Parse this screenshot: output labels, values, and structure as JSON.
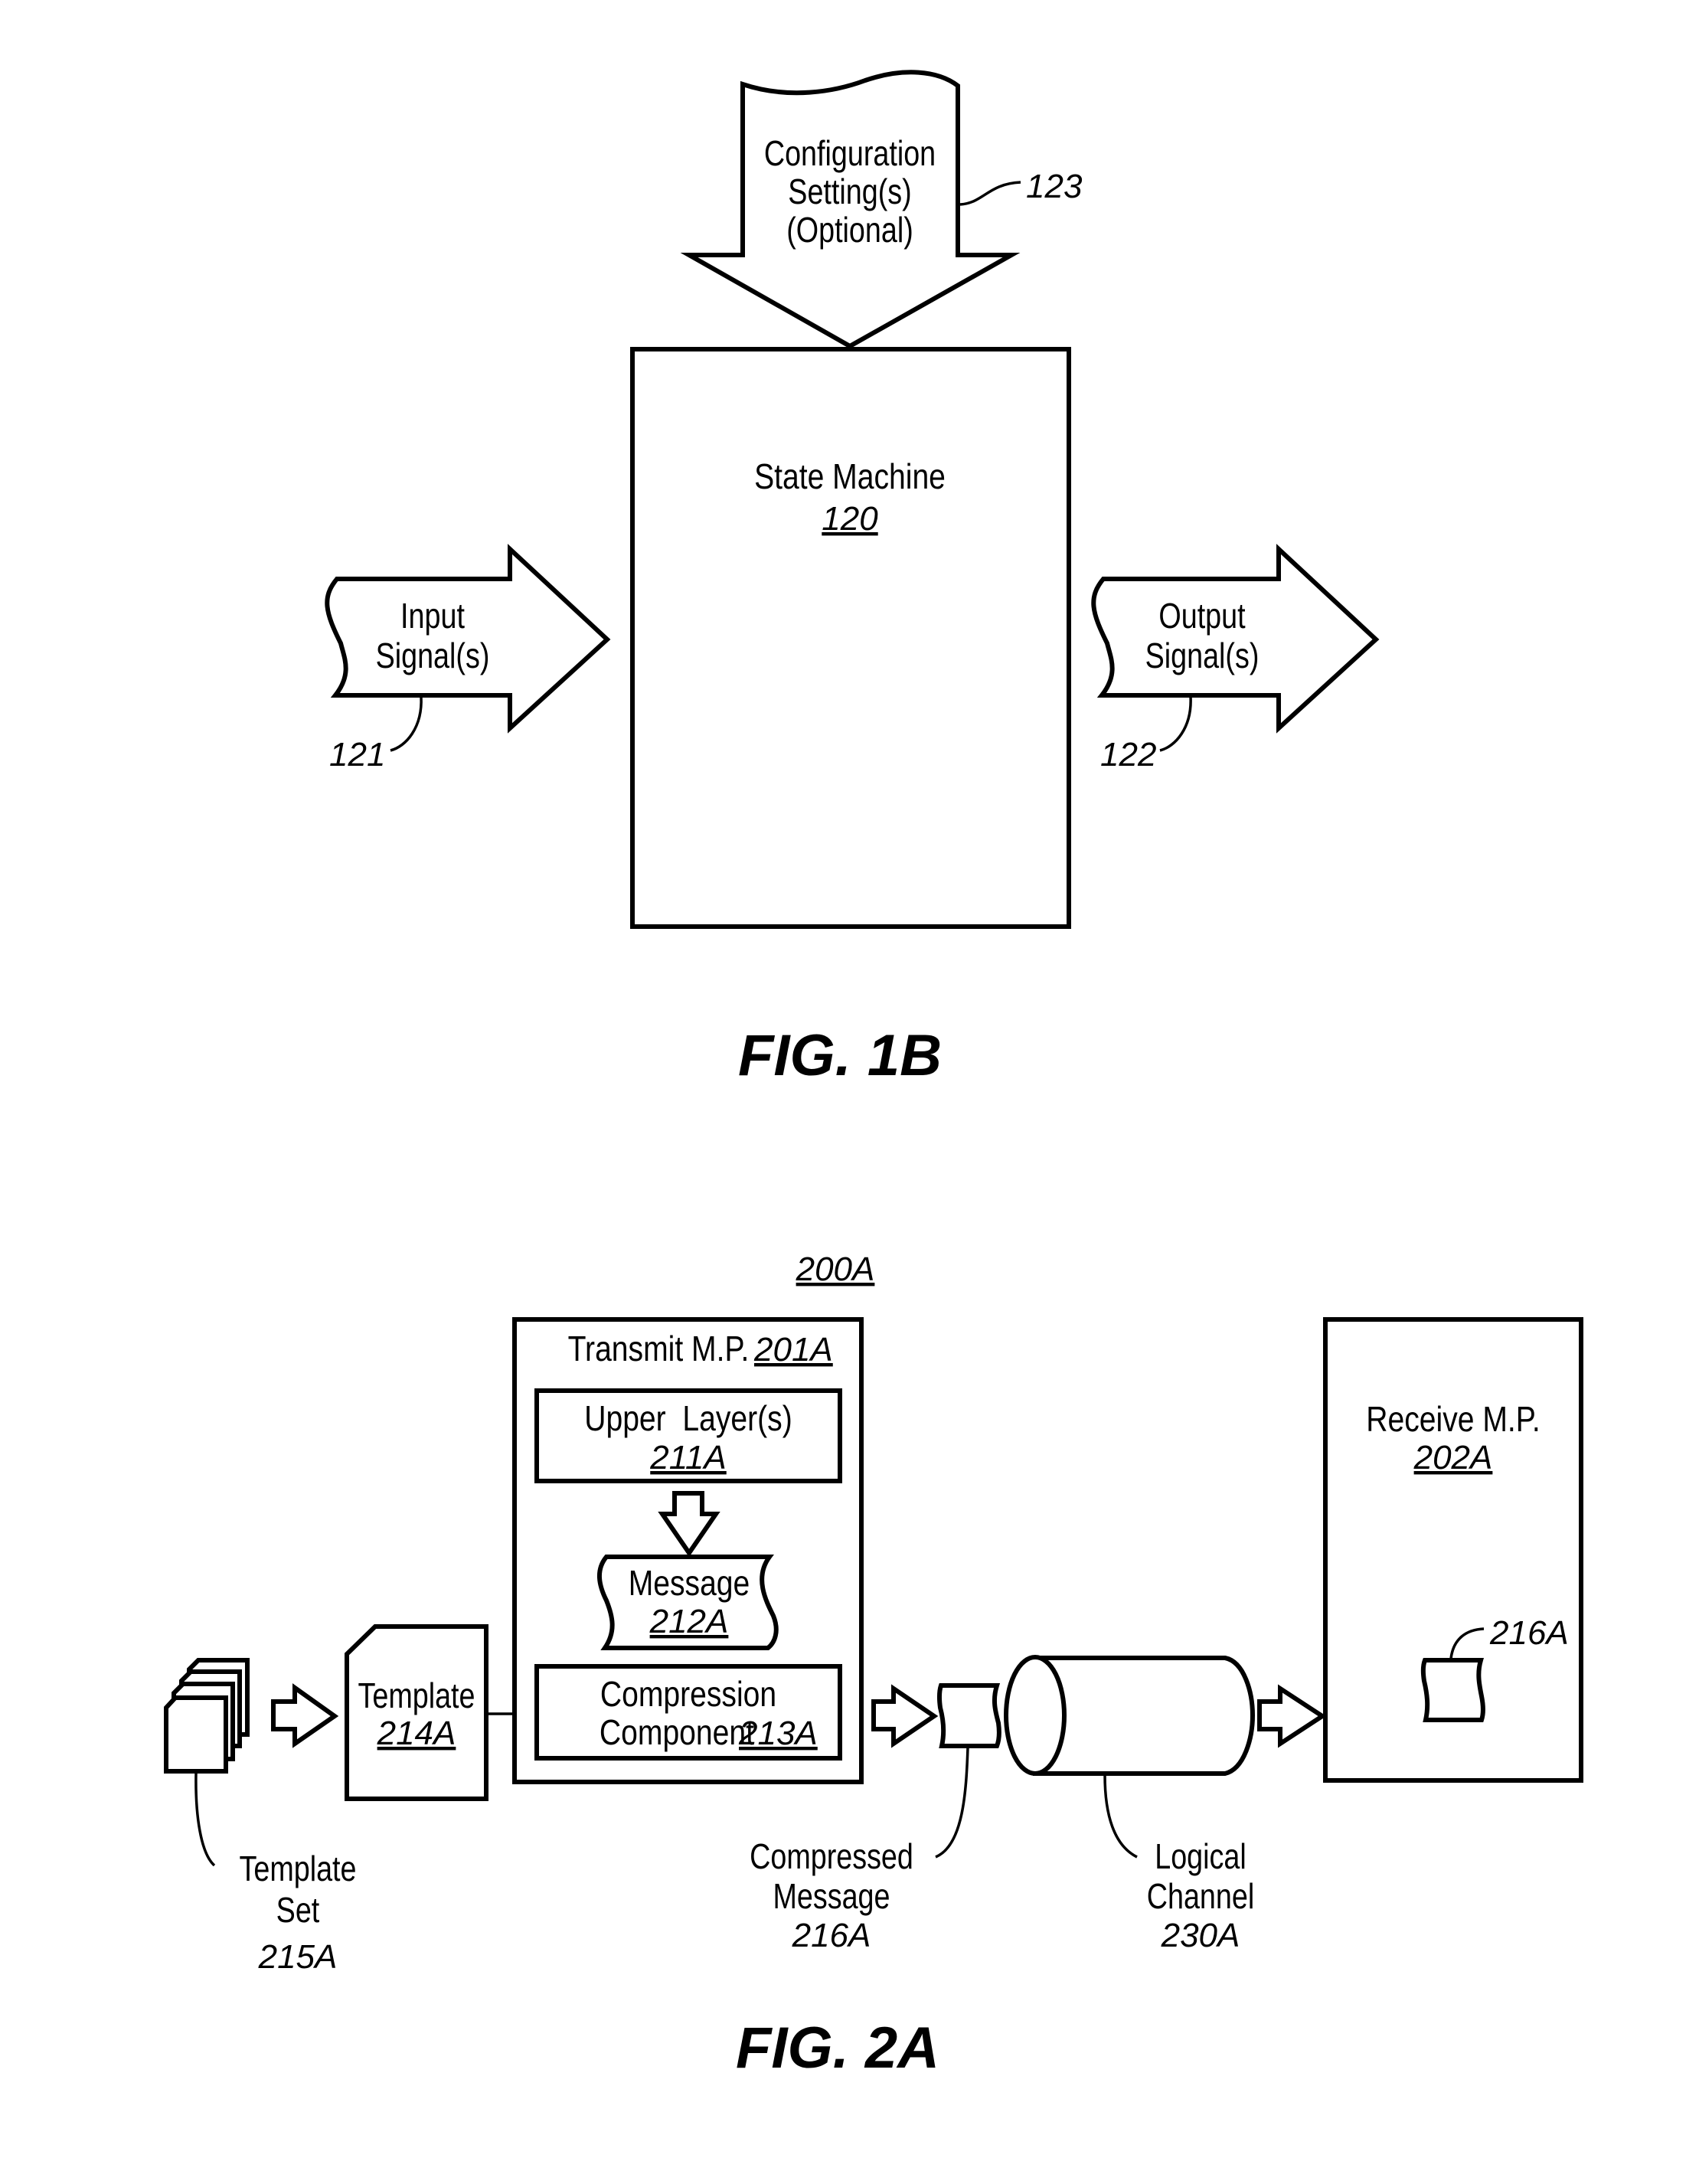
{
  "figures": [
    {
      "caption": "FIG. 1B",
      "config_arrow": {
        "lines": [
          "Configuration",
          "Setting(s)",
          "(Optional)"
        ],
        "ref": "123"
      },
      "state_machine": {
        "title": "State Machine",
        "ref": "120"
      },
      "input_arrow": {
        "lines": [
          "Input",
          "Signal(s)"
        ],
        "ref": "121"
      },
      "output_arrow": {
        "lines": [
          "Output",
          "Signal(s)"
        ],
        "ref": "122"
      }
    },
    {
      "caption": "FIG. 2A",
      "system_ref": "200A",
      "transmit": {
        "title": "Transmit M.P.",
        "ref": "201A",
        "upper_layers": {
          "title": "Upper  Layer(s)",
          "ref": "211A"
        },
        "message": {
          "title": "Message",
          "ref": "212A"
        },
        "compression": {
          "title_line1": "Compression",
          "title_line2": "Component",
          "ref": "213A"
        }
      },
      "template": {
        "title": "Template",
        "ref": "214A"
      },
      "template_set": {
        "lines": [
          "Template",
          "Set"
        ],
        "ref": "215A"
      },
      "compressed_message": {
        "lines": [
          "Compressed",
          "Message"
        ],
        "ref": "216A"
      },
      "logical_channel": {
        "lines": [
          "Logical",
          "Channel"
        ],
        "ref": "230A"
      },
      "receive": {
        "title": "Receive M.P.",
        "ref": "202A",
        "received_message_ref": "216A"
      }
    }
  ]
}
